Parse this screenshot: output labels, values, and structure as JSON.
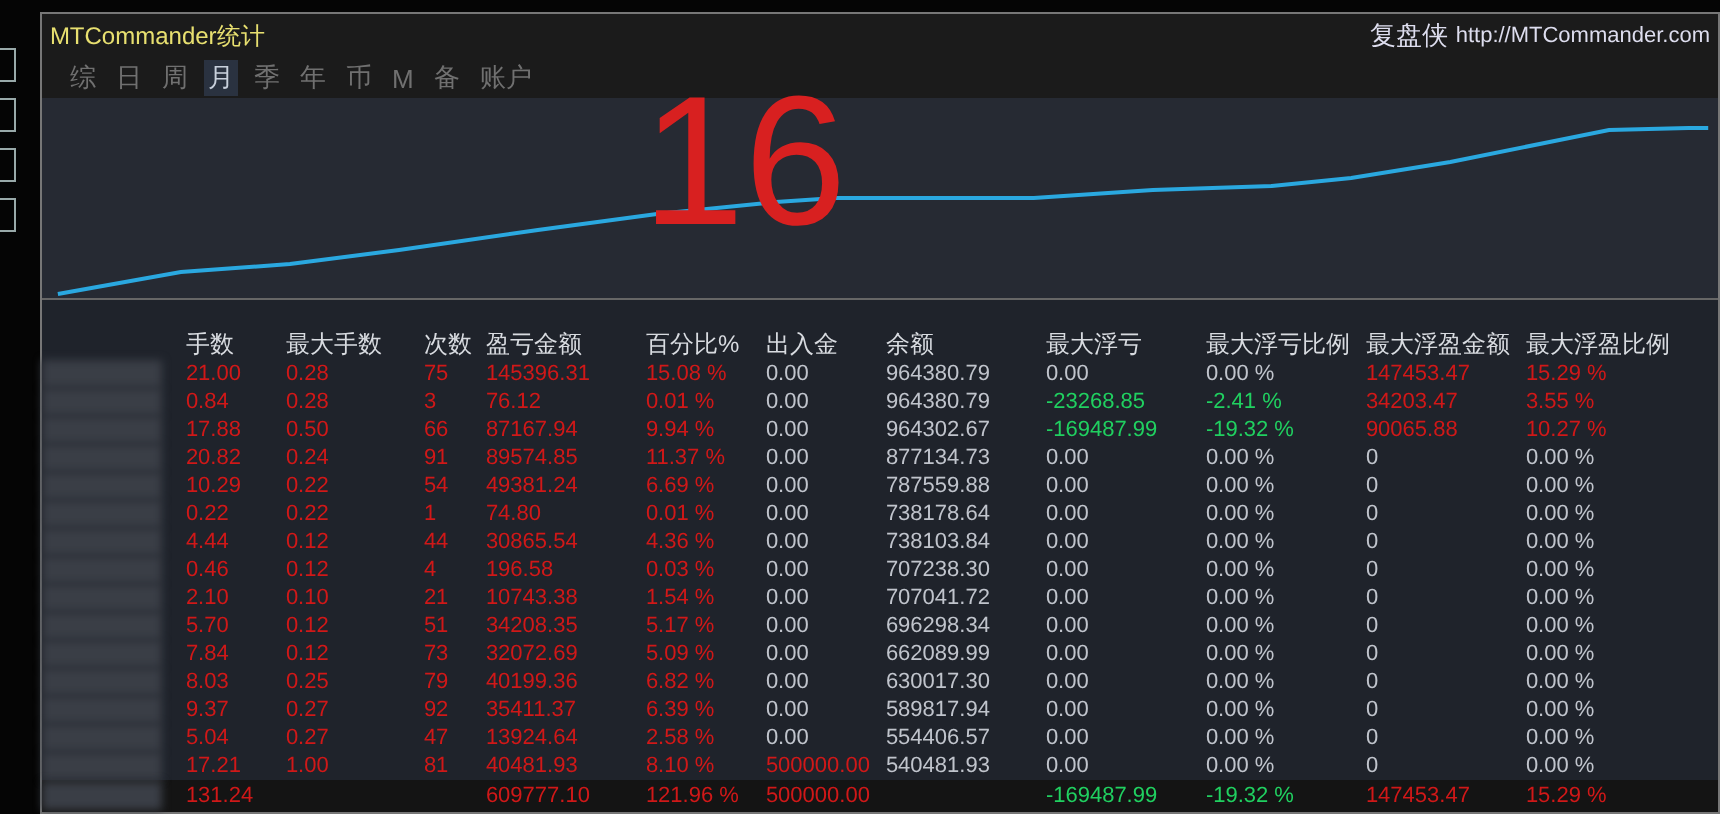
{
  "window": {
    "title": "MTCommander统计",
    "brand": "复盘侠",
    "url": "http://MTCommander.com"
  },
  "tabs": [
    {
      "label": "综",
      "selected": false
    },
    {
      "label": "日",
      "selected": false
    },
    {
      "label": "周",
      "selected": false
    },
    {
      "label": "月",
      "selected": true
    },
    {
      "label": "季",
      "selected": false
    },
    {
      "label": "年",
      "selected": false
    },
    {
      "label": "币",
      "selected": false
    },
    {
      "label": "M",
      "selected": false
    },
    {
      "label": "备",
      "selected": false
    },
    {
      "label": "账户",
      "selected": false
    }
  ],
  "annotation": "16",
  "table": {
    "columns": [
      "手数",
      "最大手数",
      "次数",
      "盈亏金额",
      "百分比%",
      "出入金",
      "余额",
      "最大浮亏",
      "最大浮亏比例",
      "最大浮盈金额",
      "最大浮盈比例"
    ],
    "rows": [
      [
        {
          "text": "21.00",
          "kind": "up"
        },
        {
          "text": "0.28",
          "kind": "up"
        },
        {
          "text": "75",
          "kind": "up"
        },
        {
          "text": "145396.31",
          "kind": "up"
        },
        {
          "text": "15.08 %",
          "kind": "up"
        },
        {
          "text": "0.00",
          "kind": "flat"
        },
        {
          "text": "964380.79",
          "kind": "flat"
        },
        {
          "text": "0.00",
          "kind": "flat"
        },
        {
          "text": "0.00 %",
          "kind": "flat"
        },
        {
          "text": "147453.47",
          "kind": "up"
        },
        {
          "text": "15.29 %",
          "kind": "up"
        }
      ],
      [
        {
          "text": "0.84",
          "kind": "up"
        },
        {
          "text": "0.28",
          "kind": "up"
        },
        {
          "text": "3",
          "kind": "up"
        },
        {
          "text": "76.12",
          "kind": "up"
        },
        {
          "text": "0.01 %",
          "kind": "up"
        },
        {
          "text": "0.00",
          "kind": "flat"
        },
        {
          "text": "964380.79",
          "kind": "flat"
        },
        {
          "text": "-23268.85",
          "kind": "down"
        },
        {
          "text": "-2.41 %",
          "kind": "down"
        },
        {
          "text": "34203.47",
          "kind": "up"
        },
        {
          "text": "3.55 %",
          "kind": "up"
        }
      ],
      [
        {
          "text": "17.88",
          "kind": "up"
        },
        {
          "text": "0.50",
          "kind": "up"
        },
        {
          "text": "66",
          "kind": "up"
        },
        {
          "text": "87167.94",
          "kind": "up"
        },
        {
          "text": "9.94 %",
          "kind": "up"
        },
        {
          "text": "0.00",
          "kind": "flat"
        },
        {
          "text": "964302.67",
          "kind": "flat"
        },
        {
          "text": "-169487.99",
          "kind": "down"
        },
        {
          "text": "-19.32 %",
          "kind": "down"
        },
        {
          "text": "90065.88",
          "kind": "up"
        },
        {
          "text": "10.27 %",
          "kind": "up"
        }
      ],
      [
        {
          "text": "20.82",
          "kind": "up"
        },
        {
          "text": "0.24",
          "kind": "up"
        },
        {
          "text": "91",
          "kind": "up"
        },
        {
          "text": "89574.85",
          "kind": "up"
        },
        {
          "text": "11.37 %",
          "kind": "up"
        },
        {
          "text": "0.00",
          "kind": "flat"
        },
        {
          "text": "877134.73",
          "kind": "flat"
        },
        {
          "text": "0.00",
          "kind": "flat"
        },
        {
          "text": "0.00 %",
          "kind": "flat"
        },
        {
          "text": "0",
          "kind": "flat"
        },
        {
          "text": "0.00 %",
          "kind": "flat"
        }
      ],
      [
        {
          "text": "10.29",
          "kind": "up"
        },
        {
          "text": "0.22",
          "kind": "up"
        },
        {
          "text": "54",
          "kind": "up"
        },
        {
          "text": "49381.24",
          "kind": "up"
        },
        {
          "text": "6.69 %",
          "kind": "up"
        },
        {
          "text": "0.00",
          "kind": "flat"
        },
        {
          "text": "787559.88",
          "kind": "flat"
        },
        {
          "text": "0.00",
          "kind": "flat"
        },
        {
          "text": "0.00 %",
          "kind": "flat"
        },
        {
          "text": "0",
          "kind": "flat"
        },
        {
          "text": "0.00 %",
          "kind": "flat"
        }
      ],
      [
        {
          "text": "0.22",
          "kind": "up"
        },
        {
          "text": "0.22",
          "kind": "up"
        },
        {
          "text": "1",
          "kind": "up"
        },
        {
          "text": "74.80",
          "kind": "up"
        },
        {
          "text": "0.01 %",
          "kind": "up"
        },
        {
          "text": "0.00",
          "kind": "flat"
        },
        {
          "text": "738178.64",
          "kind": "flat"
        },
        {
          "text": "0.00",
          "kind": "flat"
        },
        {
          "text": "0.00 %",
          "kind": "flat"
        },
        {
          "text": "0",
          "kind": "flat"
        },
        {
          "text": "0.00 %",
          "kind": "flat"
        }
      ],
      [
        {
          "text": "4.44",
          "kind": "up"
        },
        {
          "text": "0.12",
          "kind": "up"
        },
        {
          "text": "44",
          "kind": "up"
        },
        {
          "text": "30865.54",
          "kind": "up"
        },
        {
          "text": "4.36 %",
          "kind": "up"
        },
        {
          "text": "0.00",
          "kind": "flat"
        },
        {
          "text": "738103.84",
          "kind": "flat"
        },
        {
          "text": "0.00",
          "kind": "flat"
        },
        {
          "text": "0.00 %",
          "kind": "flat"
        },
        {
          "text": "0",
          "kind": "flat"
        },
        {
          "text": "0.00 %",
          "kind": "flat"
        }
      ],
      [
        {
          "text": "0.46",
          "kind": "up"
        },
        {
          "text": "0.12",
          "kind": "up"
        },
        {
          "text": "4",
          "kind": "up"
        },
        {
          "text": "196.58",
          "kind": "up"
        },
        {
          "text": "0.03 %",
          "kind": "up"
        },
        {
          "text": "0.00",
          "kind": "flat"
        },
        {
          "text": "707238.30",
          "kind": "flat"
        },
        {
          "text": "0.00",
          "kind": "flat"
        },
        {
          "text": "0.00 %",
          "kind": "flat"
        },
        {
          "text": "0",
          "kind": "flat"
        },
        {
          "text": "0.00 %",
          "kind": "flat"
        }
      ],
      [
        {
          "text": "2.10",
          "kind": "up"
        },
        {
          "text": "0.10",
          "kind": "up"
        },
        {
          "text": "21",
          "kind": "up"
        },
        {
          "text": "10743.38",
          "kind": "up"
        },
        {
          "text": "1.54 %",
          "kind": "up"
        },
        {
          "text": "0.00",
          "kind": "flat"
        },
        {
          "text": "707041.72",
          "kind": "flat"
        },
        {
          "text": "0.00",
          "kind": "flat"
        },
        {
          "text": "0.00 %",
          "kind": "flat"
        },
        {
          "text": "0",
          "kind": "flat"
        },
        {
          "text": "0.00 %",
          "kind": "flat"
        }
      ],
      [
        {
          "text": "5.70",
          "kind": "up"
        },
        {
          "text": "0.12",
          "kind": "up"
        },
        {
          "text": "51",
          "kind": "up"
        },
        {
          "text": "34208.35",
          "kind": "up"
        },
        {
          "text": "5.17 %",
          "kind": "up"
        },
        {
          "text": "0.00",
          "kind": "flat"
        },
        {
          "text": "696298.34",
          "kind": "flat"
        },
        {
          "text": "0.00",
          "kind": "flat"
        },
        {
          "text": "0.00 %",
          "kind": "flat"
        },
        {
          "text": "0",
          "kind": "flat"
        },
        {
          "text": "0.00 %",
          "kind": "flat"
        }
      ],
      [
        {
          "text": "7.84",
          "kind": "up"
        },
        {
          "text": "0.12",
          "kind": "up"
        },
        {
          "text": "73",
          "kind": "up"
        },
        {
          "text": "32072.69",
          "kind": "up"
        },
        {
          "text": "5.09 %",
          "kind": "up"
        },
        {
          "text": "0.00",
          "kind": "flat"
        },
        {
          "text": "662089.99",
          "kind": "flat"
        },
        {
          "text": "0.00",
          "kind": "flat"
        },
        {
          "text": "0.00 %",
          "kind": "flat"
        },
        {
          "text": "0",
          "kind": "flat"
        },
        {
          "text": "0.00 %",
          "kind": "flat"
        }
      ],
      [
        {
          "text": "8.03",
          "kind": "up"
        },
        {
          "text": "0.25",
          "kind": "up"
        },
        {
          "text": "79",
          "kind": "up"
        },
        {
          "text": "40199.36",
          "kind": "up"
        },
        {
          "text": "6.82 %",
          "kind": "up"
        },
        {
          "text": "0.00",
          "kind": "flat"
        },
        {
          "text": "630017.30",
          "kind": "flat"
        },
        {
          "text": "0.00",
          "kind": "flat"
        },
        {
          "text": "0.00 %",
          "kind": "flat"
        },
        {
          "text": "0",
          "kind": "flat"
        },
        {
          "text": "0.00 %",
          "kind": "flat"
        }
      ],
      [
        {
          "text": "9.37",
          "kind": "up"
        },
        {
          "text": "0.27",
          "kind": "up"
        },
        {
          "text": "92",
          "kind": "up"
        },
        {
          "text": "35411.37",
          "kind": "up"
        },
        {
          "text": "6.39 %",
          "kind": "up"
        },
        {
          "text": "0.00",
          "kind": "flat"
        },
        {
          "text": "589817.94",
          "kind": "flat"
        },
        {
          "text": "0.00",
          "kind": "flat"
        },
        {
          "text": "0.00 %",
          "kind": "flat"
        },
        {
          "text": "0",
          "kind": "flat"
        },
        {
          "text": "0.00 %",
          "kind": "flat"
        }
      ],
      [
        {
          "text": "5.04",
          "kind": "up"
        },
        {
          "text": "0.27",
          "kind": "up"
        },
        {
          "text": "47",
          "kind": "up"
        },
        {
          "text": "13924.64",
          "kind": "up"
        },
        {
          "text": "2.58 %",
          "kind": "up"
        },
        {
          "text": "0.00",
          "kind": "flat"
        },
        {
          "text": "554406.57",
          "kind": "flat"
        },
        {
          "text": "0.00",
          "kind": "flat"
        },
        {
          "text": "0.00 %",
          "kind": "flat"
        },
        {
          "text": "0",
          "kind": "flat"
        },
        {
          "text": "0.00 %",
          "kind": "flat"
        }
      ],
      [
        {
          "text": "17.21",
          "kind": "up"
        },
        {
          "text": "1.00",
          "kind": "up"
        },
        {
          "text": "81",
          "kind": "up"
        },
        {
          "text": "40481.93",
          "kind": "up"
        },
        {
          "text": "8.10 %",
          "kind": "up"
        },
        {
          "text": "500000.00",
          "kind": "up"
        },
        {
          "text": "540481.93",
          "kind": "flat"
        },
        {
          "text": "0.00",
          "kind": "flat"
        },
        {
          "text": "0.00 %",
          "kind": "flat"
        },
        {
          "text": "0",
          "kind": "flat"
        },
        {
          "text": "0.00 %",
          "kind": "flat"
        }
      ]
    ],
    "total": [
      {
        "text": "131.24",
        "kind": "up"
      },
      {
        "kind": "blank"
      },
      {
        "kind": "blank"
      },
      {
        "text": "609777.10",
        "kind": "up"
      },
      {
        "text": "121.96 %",
        "kind": "up"
      },
      {
        "text": "500000.00",
        "kind": "up"
      },
      {
        "kind": "blank"
      },
      {
        "text": "-169487.99",
        "kind": "down"
      },
      {
        "text": "-19.32 %",
        "kind": "down"
      },
      {
        "text": "147453.47",
        "kind": "up"
      },
      {
        "text": "15.29 %",
        "kind": "up"
      }
    ]
  }
}
